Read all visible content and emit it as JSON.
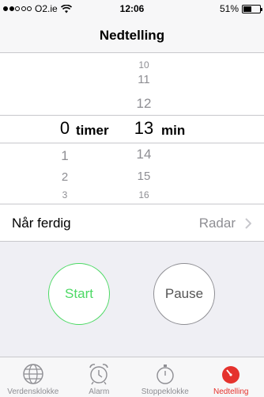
{
  "status_bar": {
    "carrier": "O2.ie",
    "time": "12:06",
    "battery": "51%",
    "battery_level": 0.51,
    "signal_bars_filled": 2,
    "signal_bars_total": 5
  },
  "nav": {
    "title": "Nedtelling"
  },
  "picker": {
    "hours": {
      "above": [],
      "selected": "0",
      "below": [
        "1",
        "2",
        "3"
      ],
      "unit": "timer"
    },
    "minutes": {
      "above": [
        "10",
        "11",
        "12"
      ],
      "selected": "13",
      "below": [
        "14",
        "15",
        "16"
      ],
      "unit": "min"
    }
  },
  "row": {
    "label": "Når ferdig",
    "value": "Radar"
  },
  "controls": {
    "start_label": "Start",
    "pause_label": "Pause"
  },
  "tabs": [
    {
      "label": "Verdensklokke",
      "icon": "globe-icon",
      "active": false
    },
    {
      "label": "Alarm",
      "icon": "alarm-clock-icon",
      "active": false
    },
    {
      "label": "Stoppeklokke",
      "icon": "stopwatch-icon",
      "active": false
    },
    {
      "label": "Nedtelling",
      "icon": "timer-icon",
      "active": true
    }
  ],
  "colors": {
    "accent_red": "#e5322d",
    "start_green": "#4cd964",
    "gray_text": "#8e8e93"
  }
}
